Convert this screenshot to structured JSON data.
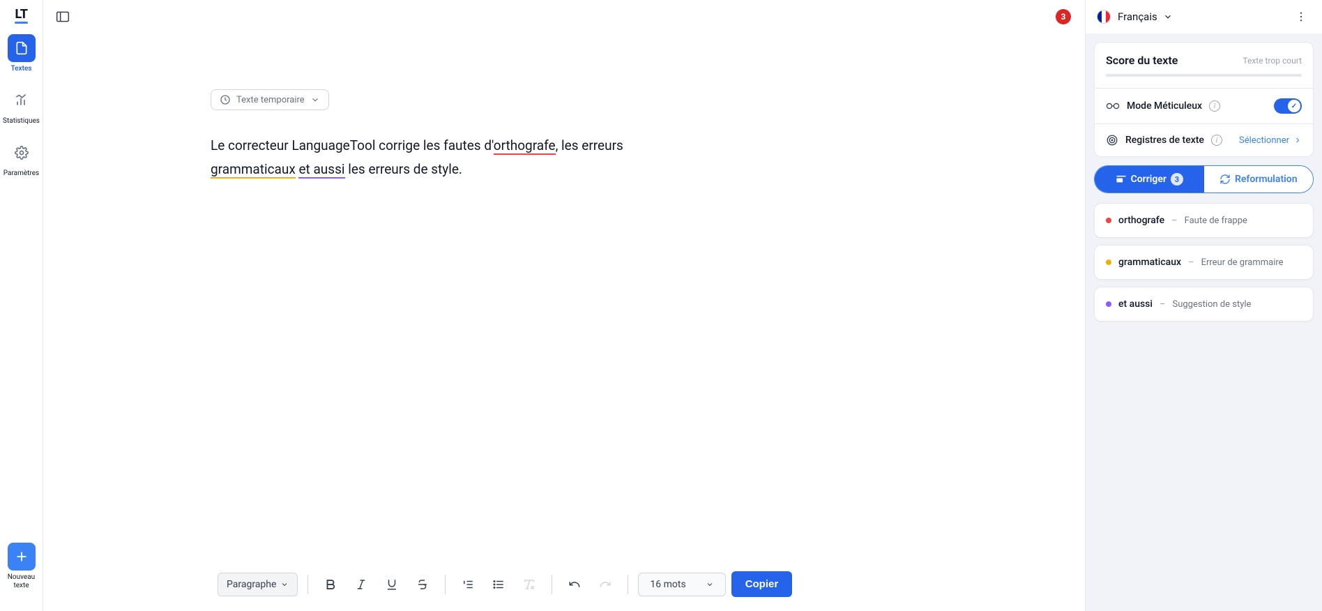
{
  "sidebar": {
    "nav": [
      {
        "label": "Textes",
        "active": true
      },
      {
        "label": "Statistiques",
        "active": false
      },
      {
        "label": "Paramètres",
        "active": false
      }
    ],
    "new_text_label": "Nouveau\ntexte"
  },
  "topbar": {
    "error_count": "3"
  },
  "editor": {
    "temp_label": "Texte temporaire",
    "text_parts": {
      "p1": "Le correcteur LanguageTool corrige les fautes d'",
      "err1": "orthografe",
      "p2": ", les erreurs ",
      "err2": "grammaticaux",
      "p3": " ",
      "err3": "et aussi",
      "p4": " les erreurs de style."
    }
  },
  "bottombar": {
    "paragraph_label": "Paragraphe",
    "word_count": "16 mots",
    "copy_label": "Copier"
  },
  "rightpanel": {
    "language": "Français",
    "score": {
      "title": "Score du texte",
      "message": "Texte trop court"
    },
    "meticulous": {
      "label": "Mode Méticuleux"
    },
    "register": {
      "label": "Registres de texte",
      "action": "Sélectionner"
    },
    "tabs": {
      "correct": "Corriger",
      "correct_count": "3",
      "reformulate": "Reformulation"
    },
    "issues": [
      {
        "word": "orthografe",
        "desc": "Faute de frappe",
        "color": "red"
      },
      {
        "word": "grammaticaux",
        "desc": "Erreur de grammaire",
        "color": "yellow"
      },
      {
        "word": "et aussi",
        "desc": "Suggestion de style",
        "color": "purple"
      }
    ]
  }
}
